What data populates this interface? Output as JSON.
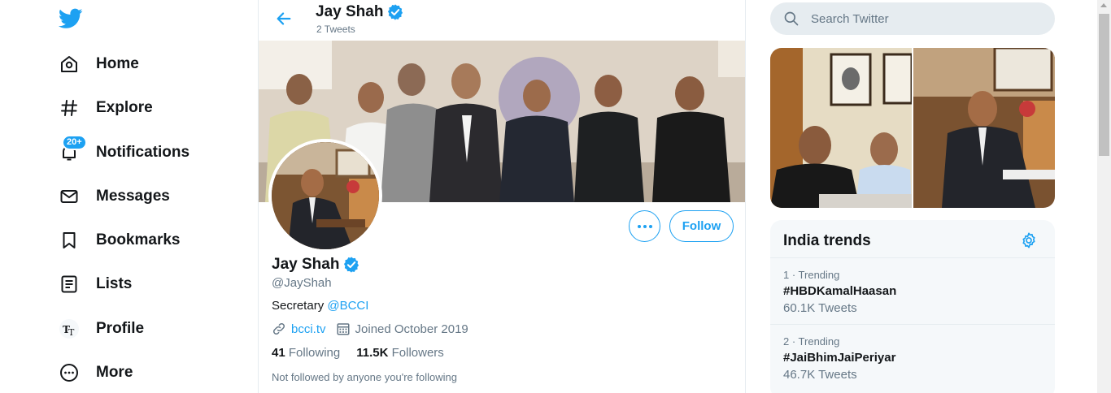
{
  "nav": {
    "items": [
      {
        "label": "Home",
        "icon": "home-icon"
      },
      {
        "label": "Explore",
        "icon": "hashtag-icon"
      },
      {
        "label": "Notifications",
        "icon": "bell-icon",
        "badge": "20+"
      },
      {
        "label": "Messages",
        "icon": "envelope-icon"
      },
      {
        "label": "Bookmarks",
        "icon": "bookmark-icon"
      },
      {
        "label": "Lists",
        "icon": "list-icon"
      },
      {
        "label": "Profile",
        "icon": "profile-avatar-icon"
      },
      {
        "label": "More",
        "icon": "more-circle-icon"
      }
    ]
  },
  "header": {
    "name": "Jay Shah",
    "tweet_count": "2 Tweets"
  },
  "profile": {
    "name": "Jay Shah",
    "handle": "@JayShah",
    "bio_text": "Secretary ",
    "bio_link": "@BCCI",
    "website": "bcci.tv",
    "joined": "Joined October 2019",
    "following_count": "41",
    "following_label": "Following",
    "followers_count": "11.5K",
    "followers_label": "Followers",
    "note": "Not followed by anyone you're following",
    "follow_label": "Follow"
  },
  "search": {
    "placeholder": "Search Twitter"
  },
  "trends": {
    "title": "India trends",
    "items": [
      {
        "meta": "1 · Trending",
        "name": "#HBDKamalHaasan",
        "count": "60.1K Tweets"
      },
      {
        "meta": "2 · Trending",
        "name": "#JaiBhimJaiPeriyar",
        "count": "46.7K Tweets"
      }
    ]
  },
  "colors": {
    "accent": "#1da1f2",
    "text": "#14171a",
    "secondary": "#657786",
    "border": "#e6ecf0"
  }
}
